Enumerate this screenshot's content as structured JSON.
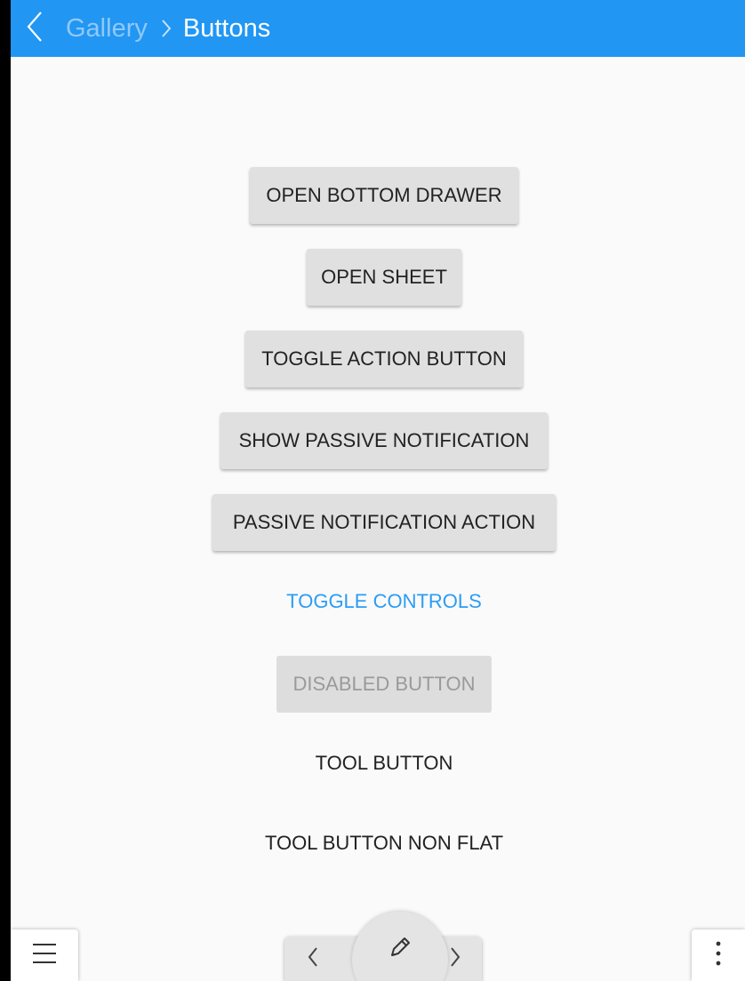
{
  "header": {
    "previous_page": "Gallery",
    "current_page": "Buttons",
    "back_icon": "chevron-left-icon",
    "separator_icon": "chevron-right-icon",
    "background_color": "#2196f3"
  },
  "buttons": {
    "open_bottom_drawer": "OPEN BOTTOM DRAWER",
    "open_sheet": "OPEN SHEET",
    "toggle_action_button": "TOGGLE ACTION BUTTON",
    "show_passive_notification": "SHOW PASSIVE NOTIFICATION",
    "passive_notification_action": "PASSIVE NOTIFICATION ACTION",
    "toggle_controls": "TOGGLE CONTROLS",
    "disabled_button": "DISABLED BUTTON",
    "tool_button": "TOOL BUTTON",
    "tool_button_non_flat": "TOOL BUTTON NON FLAT"
  },
  "bottom_bar": {
    "drawer_icon": "hamburger-menu-icon",
    "previous_icon": "chevron-left-icon",
    "action_icon": "pencil-icon",
    "next_icon": "chevron-right-icon",
    "context_menu_icon": "vertical-ellipsis-icon"
  },
  "colors": {
    "accent": "#2a9df4",
    "button_background": "#e0e0e0",
    "page_background": "#fafafa"
  }
}
